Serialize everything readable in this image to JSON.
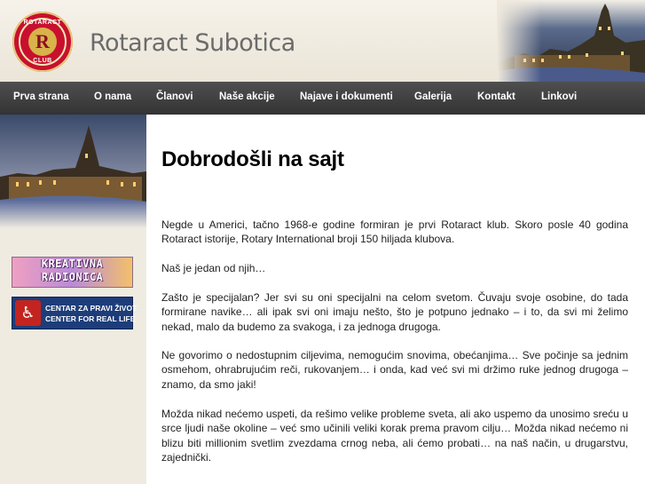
{
  "header": {
    "logo": {
      "top_text": "ROTARACT",
      "letter": "R",
      "bottom_text": "CLUB"
    },
    "site_title": "Rotaract Subotica"
  },
  "nav": {
    "items": [
      {
        "label": "Prva strana"
      },
      {
        "label": "O nama"
      },
      {
        "label": "Članovi"
      },
      {
        "label": "Naše akcije"
      },
      {
        "label": "Najave i dokumenti"
      },
      {
        "label": "Galerija"
      },
      {
        "label": "Kontakt"
      },
      {
        "label": "Linkovi"
      }
    ]
  },
  "sidebar": {
    "radionica": {
      "line1": "KREATIVNA",
      "line2": "RADIONICA"
    },
    "centar": {
      "icon": "wheelchair-icon",
      "line1": "CENTAR ZA PRAVI ŽIVOT",
      "line2": "CENTER FOR REAL LIFE"
    }
  },
  "main": {
    "title": "Dobrodošli na sajt",
    "paragraphs": [
      "Negde u Americi, tačno 1968-e godine formiran je prvi Rotaract klub. Skoro posle 40 godina Rotaract istorije, Rotary International broji 150 hiljada klubova.",
      "Naš je jedan od njih…",
      "Zašto je specijalan? Jer svi su oni specijalni na celom svetom. Čuvaju svoje osobine, do tada formirane navike… ali ipak svi oni imaju nešto, što je potpuno jednako – i to, da svi mi želimo nekad, malo da budemo za svakoga, i za jednoga drugoga.",
      "Ne govorimo o nedostupnim ciljevima, nemogućim snovima, obećanjima… Sve počinje sa jednim osmehom, ohrabrujućim reči, rukovanjem… i onda, kad već svi mi držimo ruke jednog drugoga – znamo, da smo jaki!",
      "Možda nikad nećemo uspeti, da rešimo velike probleme sveta, ali ako uspemo da unosimo sreću u srce ljudi naše okoline – već smo učinili veliki korak prema pravom cilju… Možda nikad nećemo ni blizu biti millionim svetlim zvezdama crnog neba, ali ćemo probati… na naš način, u drugarstvu, zajednički."
    ]
  },
  "colors": {
    "accent": "#c8102e",
    "nav_bg": "#3c3c3c",
    "page_bg": "#f2eee4"
  }
}
